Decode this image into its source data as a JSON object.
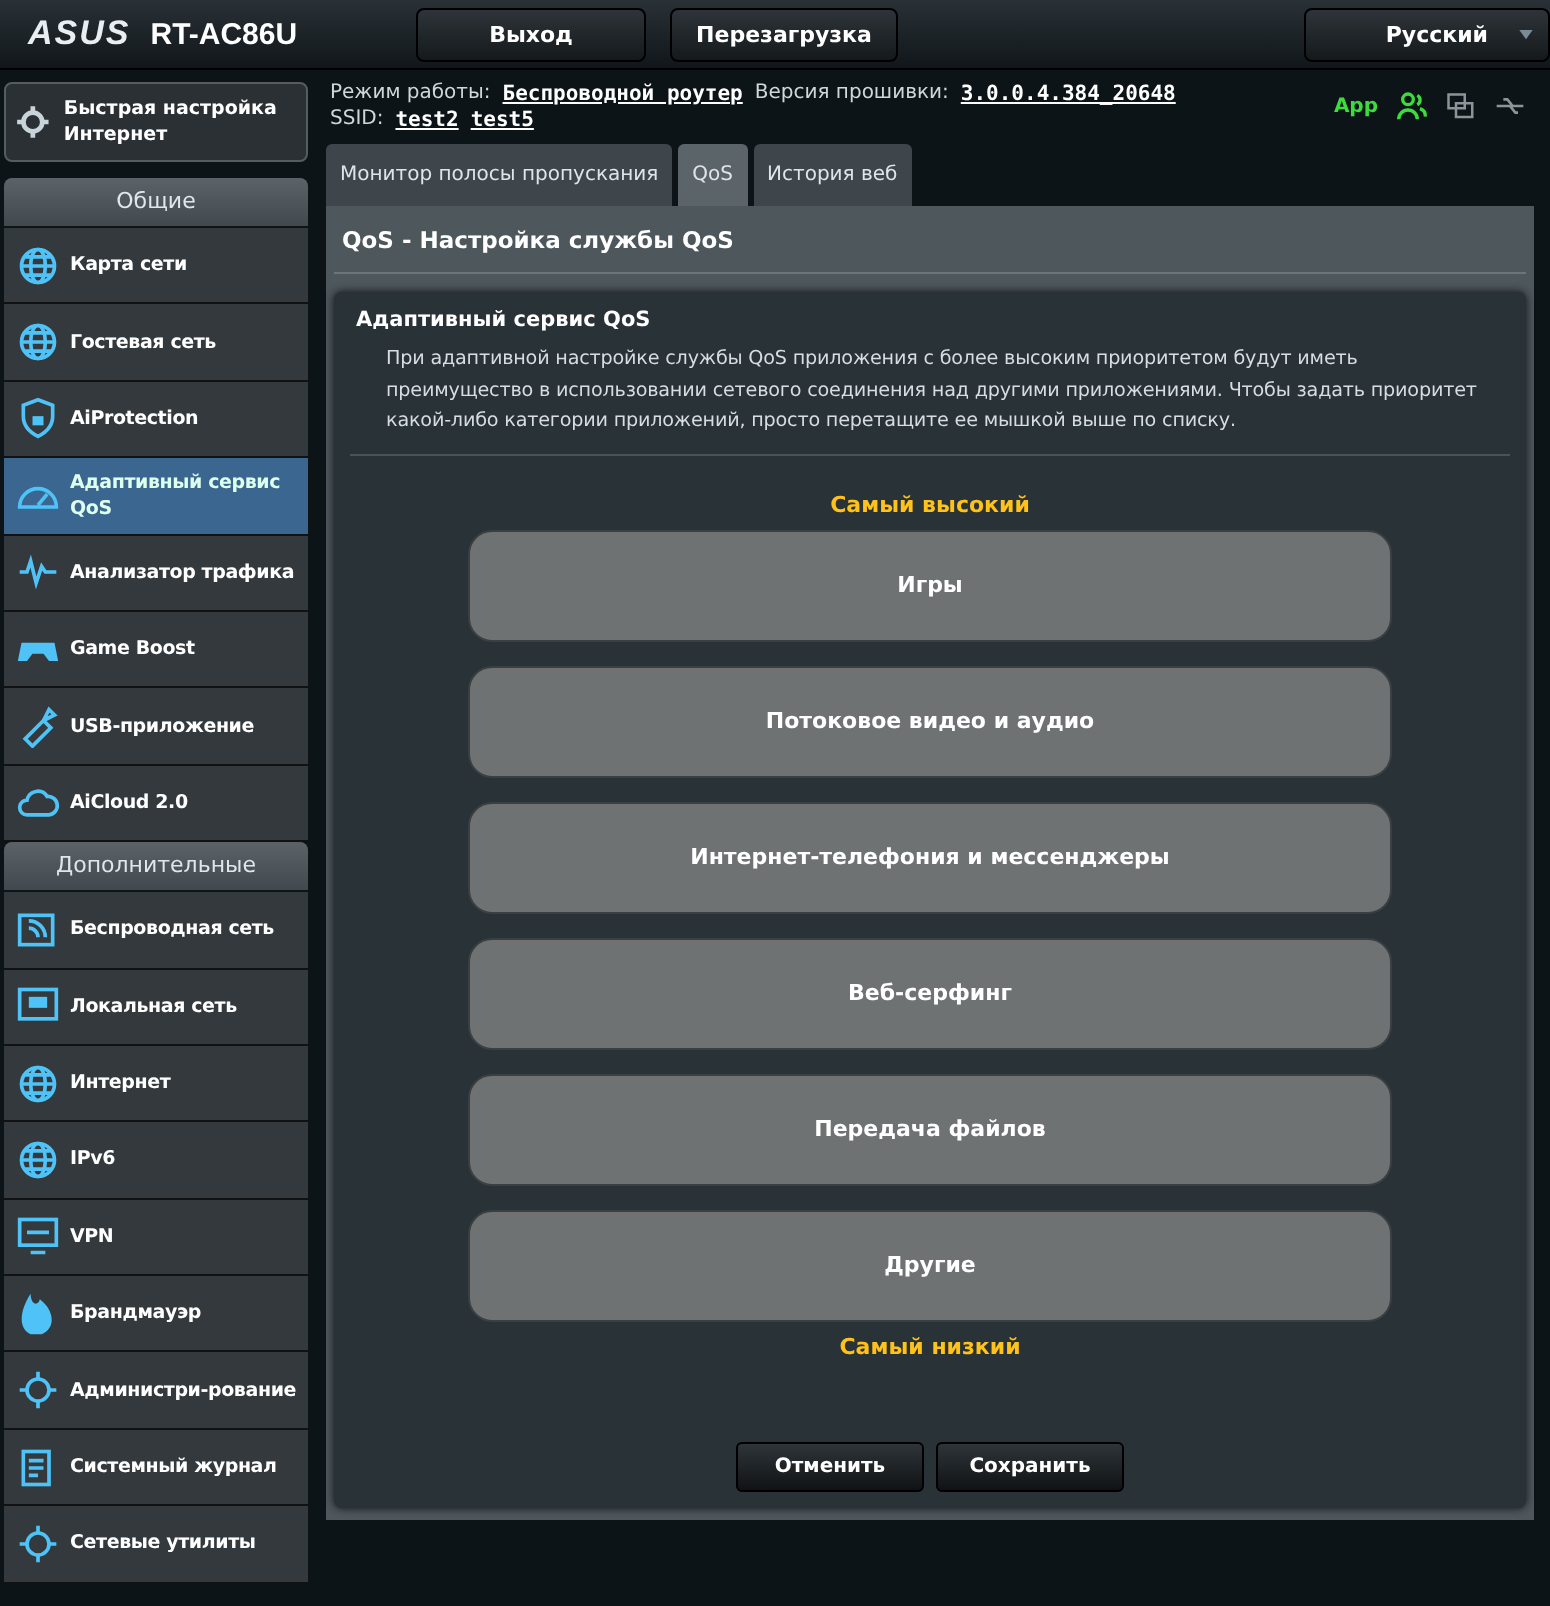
{
  "header": {
    "logo": "ASUS",
    "model": "RT-AC86U",
    "buttons": [
      "Выход",
      "Перезагрузка"
    ],
    "language": "Русский"
  },
  "info": {
    "mode_label": "Режим работы:",
    "mode": "Беспроводной роутер",
    "fw_label": "Версия прошивки:",
    "fw": "3.0.0.4.384_20648",
    "ssid_label": "SSID:",
    "ssids": [
      "test2",
      "test5"
    ],
    "app": "App"
  },
  "sidebar": {
    "quick_setup": "Быстрая настройка Интернет",
    "sections": [
      {
        "title": "Общие",
        "items": [
          {
            "label": "Карта сети",
            "selected": false
          },
          {
            "label": "Гостевая сеть",
            "selected": false
          },
          {
            "label": "AiProtection",
            "selected": false
          },
          {
            "label": "Адаптивный сервис QoS",
            "selected": true
          },
          {
            "label": "Анализатор трафика",
            "selected": false
          },
          {
            "label": "Game Boost",
            "selected": false
          },
          {
            "label": "USB-приложение",
            "selected": false
          },
          {
            "label": "AiCloud 2.0",
            "selected": false
          }
        ]
      },
      {
        "title": "Дополнительные",
        "items": [
          {
            "label": "Беспроводная сеть",
            "selected": false
          },
          {
            "label": "Локальная сеть",
            "selected": false
          },
          {
            "label": "Интернет",
            "selected": false
          },
          {
            "label": "IPv6",
            "selected": false
          },
          {
            "label": "VPN",
            "selected": false
          },
          {
            "label": "Брандмауэр",
            "selected": false
          },
          {
            "label": "Администри-рование",
            "selected": false
          },
          {
            "label": "Системный журнал",
            "selected": false
          },
          {
            "label": "Сетевые утилиты",
            "selected": false
          }
        ]
      }
    ]
  },
  "tabs": [
    {
      "label": "Монитор полосы пропускания",
      "selected": false
    },
    {
      "label": "QoS",
      "selected": true
    },
    {
      "label": "История веб",
      "selected": false
    }
  ],
  "page": {
    "title": "QoS - Настройка службы QoS",
    "card_title": "Адаптивный сервис QoS",
    "description": "При адаптивной настройке службы QoS приложения с более высоким приоритетом будут иметь преимущество в использовании сетевого соединения над другими приложениями. Чтобы задать приоритет какой-либо категории приложений, просто перетащите ее мышкой выше по списку.",
    "highest": "Самый высокий",
    "categories": [
      "Игры",
      "Потоковое видео и аудио",
      "Интернет-телефония и мессенджеры",
      "Веб-серфинг",
      "Передача файлов",
      "Другие"
    ],
    "lowest": "Самый низкий",
    "buttons": [
      "Отменить",
      "Сохранить"
    ]
  }
}
